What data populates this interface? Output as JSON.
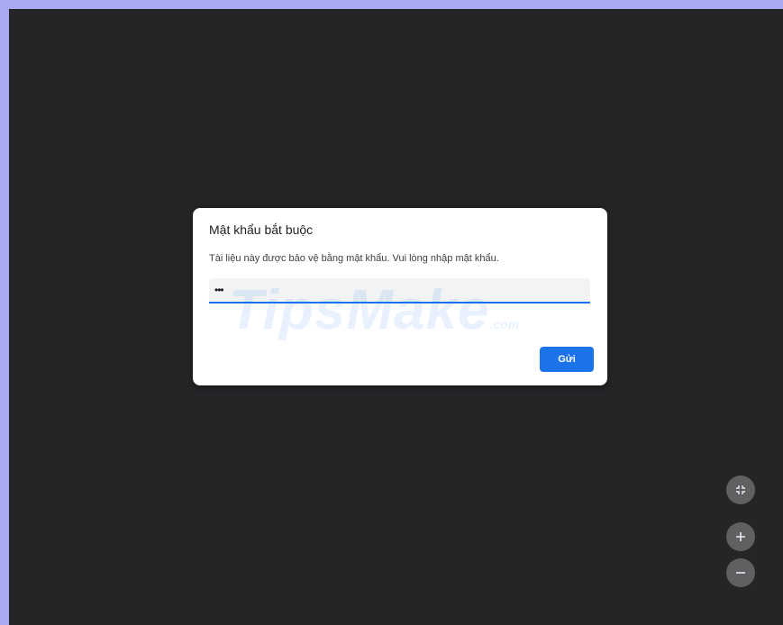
{
  "dialog": {
    "title": "Mật khẩu bắt buộc",
    "description": "Tài liệu này được bảo vệ bằng mật khẩu. Vui lòng nhập mật khẩu.",
    "password_value": "•••",
    "submit_label": "Gửi"
  },
  "watermark": {
    "text": "TipsMake",
    "suffix": ".com"
  },
  "controls": {
    "fit_icon": "fit-to-page-icon",
    "zoom_in_icon": "zoom-in-icon",
    "zoom_out_icon": "zoom-out-icon"
  },
  "colors": {
    "frame": "#a9a9f2",
    "viewer_background": "#252528",
    "accent": "#1a73e8",
    "control_button": "#5f6062"
  }
}
